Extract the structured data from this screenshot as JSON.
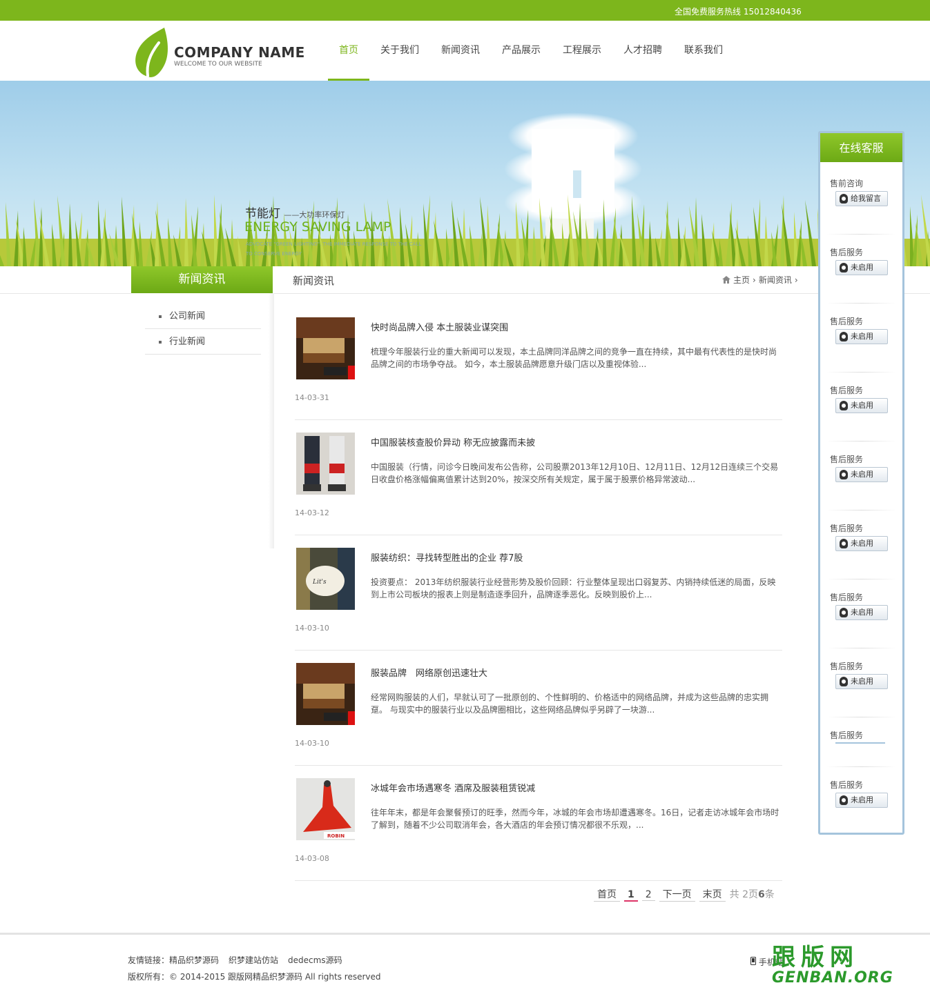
{
  "topbar": {
    "hotline": "全国免费服务热线 15012840436"
  },
  "logo": {
    "name": "COMPANY NAME",
    "tagline": "WELCOME TO OUR WEBSITE"
  },
  "nav": [
    {
      "label": "首页",
      "active": true
    },
    {
      "label": "关于我们"
    },
    {
      "label": "新闻资讯"
    },
    {
      "label": "产品展示"
    },
    {
      "label": "工程展示"
    },
    {
      "label": "人才招聘"
    },
    {
      "label": "联系我们"
    }
  ],
  "banner": {
    "title": "节能灯",
    "subtitle": "——大功率环保灯",
    "en_title": "ENERGY SAVING LAMP",
    "desc": "ADVOCATE \"GREEN LIGHTING\". THE IMMEDIATE RESPONSE TO THE CALL TO CONSERVE ENERGY"
  },
  "sidebar": {
    "heading": "新闻资讯",
    "items": [
      {
        "label": "公司新闻"
      },
      {
        "label": "行业新闻"
      }
    ]
  },
  "content": {
    "title": "新闻资讯",
    "breadcrumb": {
      "home": "主页",
      "current": "新闻资讯"
    }
  },
  "news": [
    {
      "title": "快时尚品牌入侵 本土服装业谋突围",
      "summary": "梳理今年服装行业的重大新闻可以发现，本土品牌同洋品牌之间的竞争一直在持续，其中最有代表性的是快时尚品牌之间的市场争夺战。 如今，本土服装品牌愿意升级门店以及重视体验...",
      "date": "14-03-31",
      "thumb": "bedroom"
    },
    {
      "title": "中国服装核查股价异动 称无应披露而未披",
      "summary": "中国服装（行情，问诊今日晚间发布公告称，公司股票2013年12月10日、12月11日、12月12日连续三个交易日收盘价格涨幅偏离值累计达到20%，按深交所有关规定，属于属于股票价格异常波动...",
      "date": "14-03-12",
      "thumb": "pants"
    },
    {
      "title": "服装纺织：寻找转型胜出的企业 荐7股",
      "summary": "投资要点： 2013年纺织服装行业经营形势及股价回顾：行业整体呈现出口弱复苏、内销持续低迷的局面，反映到上市公司板块的报表上则是制造逐季回升，品牌逐季恶化。反映到股价上...",
      "date": "14-03-10",
      "thumb": "tag"
    },
    {
      "title": "服装品牌　网络原创迅速壮大",
      "summary": "经常网购服装的人们，早就认可了一批原创的、个性鲜明的、价格适中的网络品牌，并成为这些品牌的忠实拥趸。 与现实中的服装行业以及品牌圈相比，这些网络品牌似乎另辟了一块游...",
      "date": "14-03-10",
      "thumb": "bedroom"
    },
    {
      "title": "冰城年会市场遇寒冬 酒席及服装租赁锐减",
      "summary": "往年年末，都是年会聚餐预订的旺季，然而今年，冰城的年会市场却遭遇寒冬。16日，记者走访冰城年会市场时了解到，随着不少公司取消年会，各大酒店的年会预订情况都很不乐观，...",
      "date": "14-03-08",
      "thumb": "dress"
    }
  ],
  "pager": {
    "first": "首页",
    "pages": [
      "1",
      "2"
    ],
    "current": "1",
    "next": "下一页",
    "last": "末页",
    "info_prefix": "共",
    "info_pages": "2",
    "info_mid": "页",
    "info_count": "6",
    "info_suffix": "条"
  },
  "footer": {
    "links_label": "友情链接：",
    "links": [
      "精品织梦源码",
      "织梦建站仿站",
      "dedecms源码"
    ],
    "copyright": "版权所有：© 2014-2015 跟版网精品织梦源码 All rights reserved",
    "mobile": "手机站",
    "watermark_cn": "跟版网",
    "watermark_en": "GENBAN.ORG"
  },
  "customer_service": {
    "heading": "在线客服",
    "groups": [
      {
        "label": "售前咨询",
        "button": "给我留言"
      },
      {
        "label": "售后服务",
        "button": "未启用"
      },
      {
        "label": "售后服务",
        "button": "未启用"
      },
      {
        "label": "售后服务",
        "button": "未启用"
      },
      {
        "label": "售后服务",
        "button": "未启用"
      },
      {
        "label": "售后服务",
        "button": "未启用"
      },
      {
        "label": "售后服务",
        "button": "未启用"
      },
      {
        "label": "售后服务",
        "button": "未启用"
      },
      {
        "label": "售后服务",
        "button": ""
      },
      {
        "label": "售后服务",
        "button": "未启用"
      }
    ]
  },
  "colors": {
    "brand_green": "#7db61c",
    "cs_border": "#a5c4dc"
  }
}
